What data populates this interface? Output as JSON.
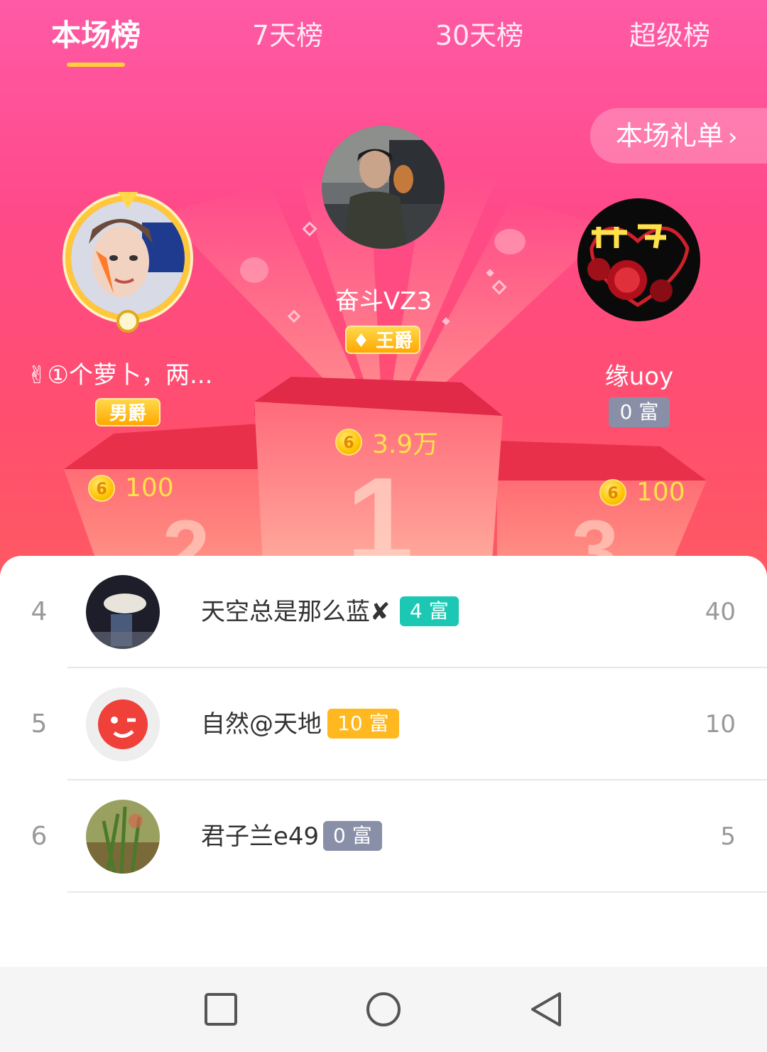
{
  "tabs": [
    {
      "label": "本场榜",
      "active": true
    },
    {
      "label": "7天榜",
      "active": false
    },
    {
      "label": "30天榜",
      "active": false
    },
    {
      "label": "超级榜",
      "active": false
    }
  ],
  "gift_list_button": {
    "label": "本场礼单",
    "chevron": "›"
  },
  "podium": {
    "first": {
      "name": "奋斗VZ3",
      "badge": "王爵",
      "score": "3.9万",
      "rank_numeral": "1"
    },
    "second": {
      "name": "✌①个萝卜，两...",
      "badge": "男爵",
      "score": "100",
      "rank_numeral": "2"
    },
    "third": {
      "name": "缘uoy",
      "badge": "0 富",
      "score": "100",
      "rank_numeral": "3"
    }
  },
  "coin_glyph": "6",
  "list": [
    {
      "rank": "4",
      "name": "天空总是那么蓝✘",
      "badge": "4 富",
      "badge_color": "#1cc8b4",
      "value": "40"
    },
    {
      "rank": "5",
      "name": "自然@天地",
      "badge": "10 富",
      "badge_color": "#ffb81f",
      "value": "10"
    },
    {
      "rank": "6",
      "name": "君子兰e49",
      "badge": "0 富",
      "badge_color": "#8a8fa8",
      "value": "5"
    }
  ],
  "colors": {
    "accent_yellow": "#ffcf3a",
    "hero_pink": "#ff4a8a"
  },
  "icons": {
    "nav_recent": "square-icon",
    "nav_home": "circle-icon",
    "nav_back": "triangle-back-icon"
  }
}
